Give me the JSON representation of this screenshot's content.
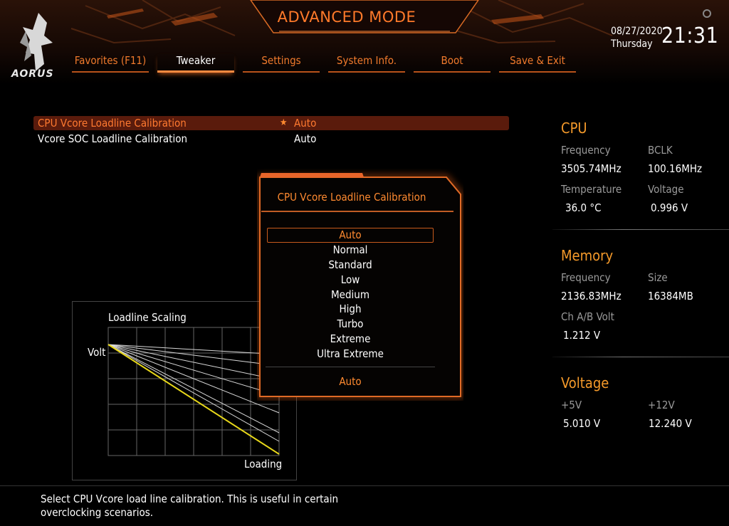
{
  "brand": {
    "logo_text": "AORUS"
  },
  "header": {
    "title": "ADVANCED MODE",
    "date": "08/27/2020",
    "weekday": "Thursday",
    "time": "21:31"
  },
  "tabs": [
    {
      "label": "Favorites (F11)"
    },
    {
      "label": "Tweaker",
      "active": true
    },
    {
      "label": "Settings"
    },
    {
      "label": "System Info."
    },
    {
      "label": "Boot"
    },
    {
      "label": "Save & Exit"
    }
  ],
  "settings": [
    {
      "label": "CPU Vcore Loadline Calibration",
      "value": "Auto",
      "selected": true
    },
    {
      "label": "Vcore SOC Loadline Calibration",
      "value": "Auto"
    }
  ],
  "cpu": {
    "title": "CPU",
    "frequency_label": "Frequency",
    "frequency": "3505.74MHz",
    "bclk_label": "BCLK",
    "bclk": "100.16MHz",
    "temp_label": "Temperature",
    "temp": "36.0 °C",
    "voltage_label": "Voltage",
    "voltage": "0.996 V"
  },
  "memory": {
    "title": "Memory",
    "frequency_label": "Frequency",
    "frequency": "2136.83MHz",
    "size_label": "Size",
    "size": "16384MB",
    "volt_label": "Ch A/B Volt",
    "volt": "1.212 V"
  },
  "voltage": {
    "title": "Voltage",
    "v5_label": "+5V",
    "v5": "5.010 V",
    "v12_label": "+12V",
    "v12": "12.240 V"
  },
  "graph": {
    "title": "Loadline Scaling",
    "ylabel": "Volt",
    "xlabel": "Loading"
  },
  "popup": {
    "title": "CPU Vcore Loadline Calibration",
    "options": [
      "Auto",
      "Normal",
      "Standard",
      "Low",
      "Medium",
      "High",
      "Turbo",
      "Extreme",
      "Ultra Extreme"
    ],
    "selected_index": 0,
    "current_value": "Auto"
  },
  "help_text": "Select CPU Vcore load line calibration. This is useful in certain overclocking scenarios.",
  "colors": {
    "accent": "#ff7a2a",
    "section_title": "#f59a2a",
    "selected_row": "#5a1b0c",
    "graph_line": "#e8d81a"
  }
}
